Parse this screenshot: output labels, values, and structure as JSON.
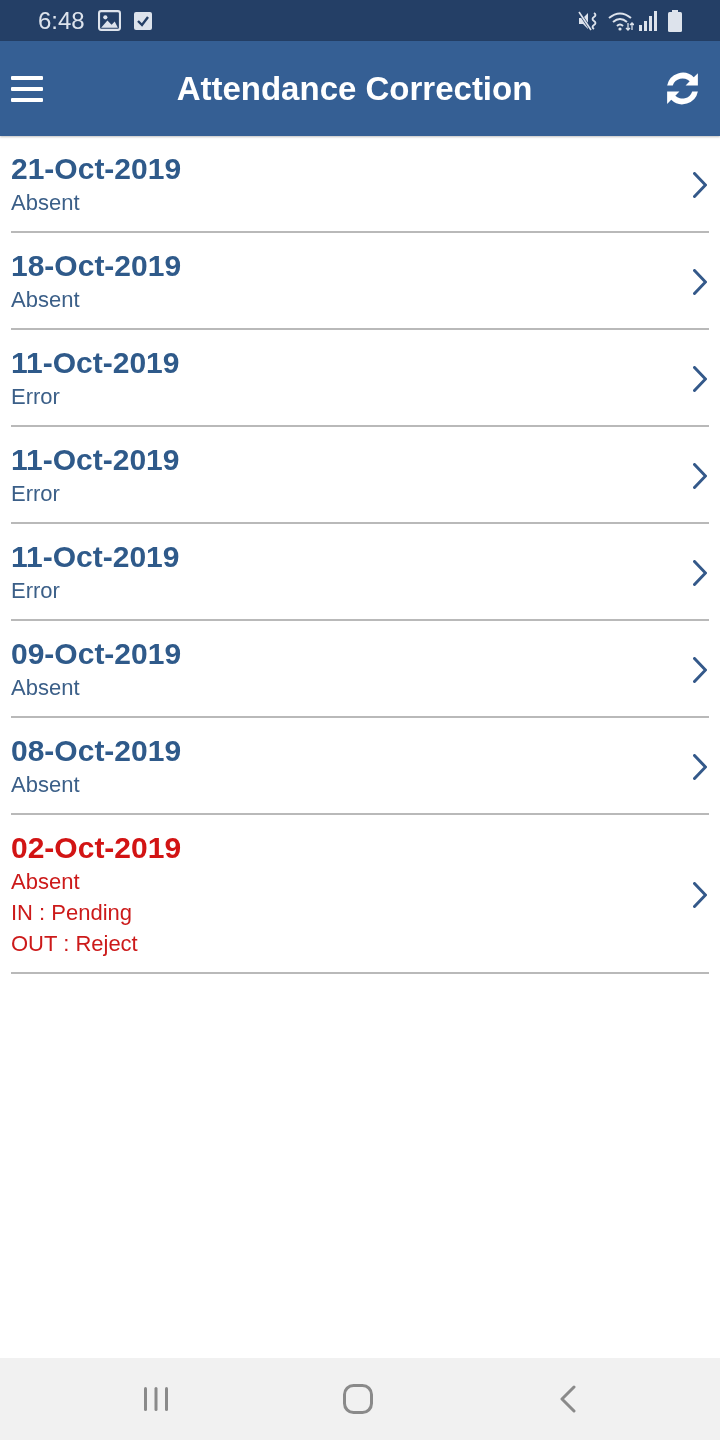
{
  "status_bar": {
    "time": "6:48"
  },
  "app_bar": {
    "title": "Attendance Correction"
  },
  "records": [
    {
      "date": "21-Oct-2019",
      "status": "Absent",
      "highlighted": false
    },
    {
      "date": "18-Oct-2019",
      "status": "Absent",
      "highlighted": false
    },
    {
      "date": "11-Oct-2019",
      "status": "Error",
      "highlighted": false
    },
    {
      "date": "11-Oct-2019",
      "status": "Error",
      "highlighted": false
    },
    {
      "date": "11-Oct-2019",
      "status": "Error",
      "highlighted": false
    },
    {
      "date": "09-Oct-2019",
      "status": "Absent",
      "highlighted": false
    },
    {
      "date": "08-Oct-2019",
      "status": "Absent",
      "highlighted": false
    },
    {
      "date": "02-Oct-2019",
      "status": "Absent",
      "highlighted": true,
      "details": [
        "IN : Pending",
        "OUT : Reject"
      ]
    }
  ]
}
